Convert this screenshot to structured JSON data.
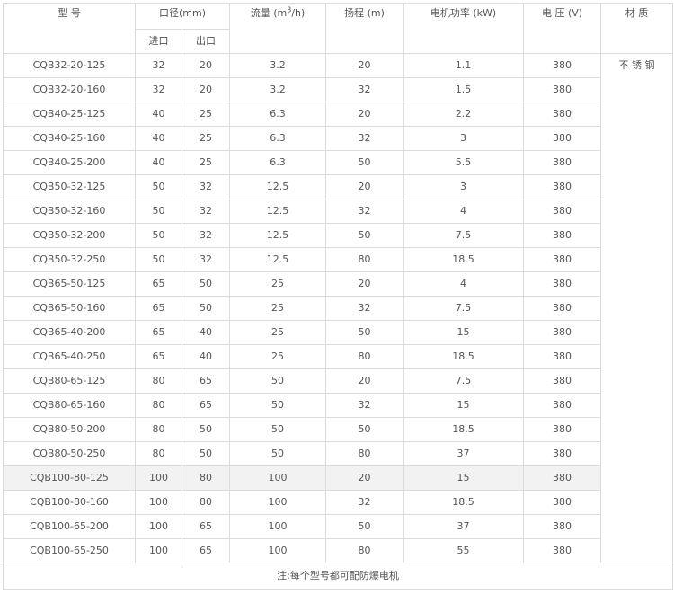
{
  "headers": {
    "model": "型 号",
    "caliber": "口径(mm)",
    "inlet": "进口",
    "outlet": "出口",
    "flow_prefix": "流量 (m",
    "flow_sup": "3",
    "flow_suffix": "/h)",
    "head": "扬程 (m)",
    "power": "电机功率 (kW)",
    "voltage": "电 压 (V)",
    "material": "材 质"
  },
  "material_value": "不 锈 钢",
  "note": "注:每个型号都可配防爆电机",
  "highlight_row_index": 17,
  "rows": [
    {
      "model": "CQB32-20-125",
      "inlet": "32",
      "outlet": "20",
      "flow": "3.2",
      "head": "20",
      "power": "1.1",
      "voltage": "380"
    },
    {
      "model": "CQB32-20-160",
      "inlet": "32",
      "outlet": "20",
      "flow": "3.2",
      "head": "32",
      "power": "1.5",
      "voltage": "380"
    },
    {
      "model": "CQB40-25-125",
      "inlet": "40",
      "outlet": "25",
      "flow": "6.3",
      "head": "20",
      "power": "2.2",
      "voltage": "380"
    },
    {
      "model": "CQB40-25-160",
      "inlet": "40",
      "outlet": "25",
      "flow": "6.3",
      "head": "32",
      "power": "3",
      "voltage": "380"
    },
    {
      "model": "CQB40-25-200",
      "inlet": "40",
      "outlet": "25",
      "flow": "6.3",
      "head": "50",
      "power": "5.5",
      "voltage": "380"
    },
    {
      "model": "CQB50-32-125",
      "inlet": "50",
      "outlet": "32",
      "flow": "12.5",
      "head": "20",
      "power": "3",
      "voltage": "380"
    },
    {
      "model": "CQB50-32-160",
      "inlet": "50",
      "outlet": "32",
      "flow": "12.5",
      "head": "32",
      "power": "4",
      "voltage": "380"
    },
    {
      "model": "CQB50-32-200",
      "inlet": "50",
      "outlet": "32",
      "flow": "12.5",
      "head": "50",
      "power": "7.5",
      "voltage": "380"
    },
    {
      "model": "CQB50-32-250",
      "inlet": "50",
      "outlet": "32",
      "flow": "12.5",
      "head": "80",
      "power": "18.5",
      "voltage": "380"
    },
    {
      "model": "CQB65-50-125",
      "inlet": "65",
      "outlet": "50",
      "flow": "25",
      "head": "20",
      "power": "4",
      "voltage": "380"
    },
    {
      "model": "CQB65-50-160",
      "inlet": "65",
      "outlet": "50",
      "flow": "25",
      "head": "32",
      "power": "7.5",
      "voltage": "380"
    },
    {
      "model": "CQB65-40-200",
      "inlet": "65",
      "outlet": "40",
      "flow": "25",
      "head": "50",
      "power": "15",
      "voltage": "380"
    },
    {
      "model": "CQB65-40-250",
      "inlet": "65",
      "outlet": "40",
      "flow": "25",
      "head": "80",
      "power": "18.5",
      "voltage": "380"
    },
    {
      "model": "CQB80-65-125",
      "inlet": "80",
      "outlet": "65",
      "flow": "50",
      "head": "20",
      "power": "7.5",
      "voltage": "380"
    },
    {
      "model": "CQB80-65-160",
      "inlet": "80",
      "outlet": "65",
      "flow": "50",
      "head": "32",
      "power": "15",
      "voltage": "380"
    },
    {
      "model": "CQB80-50-200",
      "inlet": "80",
      "outlet": "50",
      "flow": "50",
      "head": "50",
      "power": "18.5",
      "voltage": "380"
    },
    {
      "model": "CQB80-50-250",
      "inlet": "80",
      "outlet": "50",
      "flow": "50",
      "head": "80",
      "power": "37",
      "voltage": "380"
    },
    {
      "model": "CQB100-80-125",
      "inlet": "100",
      "outlet": "80",
      "flow": "100",
      "head": "20",
      "power": "15",
      "voltage": "380"
    },
    {
      "model": "CQB100-80-160",
      "inlet": "100",
      "outlet": "80",
      "flow": "100",
      "head": "32",
      "power": "18.5",
      "voltage": "380"
    },
    {
      "model": "CQB100-65-200",
      "inlet": "100",
      "outlet": "65",
      "flow": "100",
      "head": "50",
      "power": "37",
      "voltage": "380"
    },
    {
      "model": "CQB100-65-250",
      "inlet": "100",
      "outlet": "65",
      "flow": "100",
      "head": "80",
      "power": "55",
      "voltage": "380"
    }
  ]
}
